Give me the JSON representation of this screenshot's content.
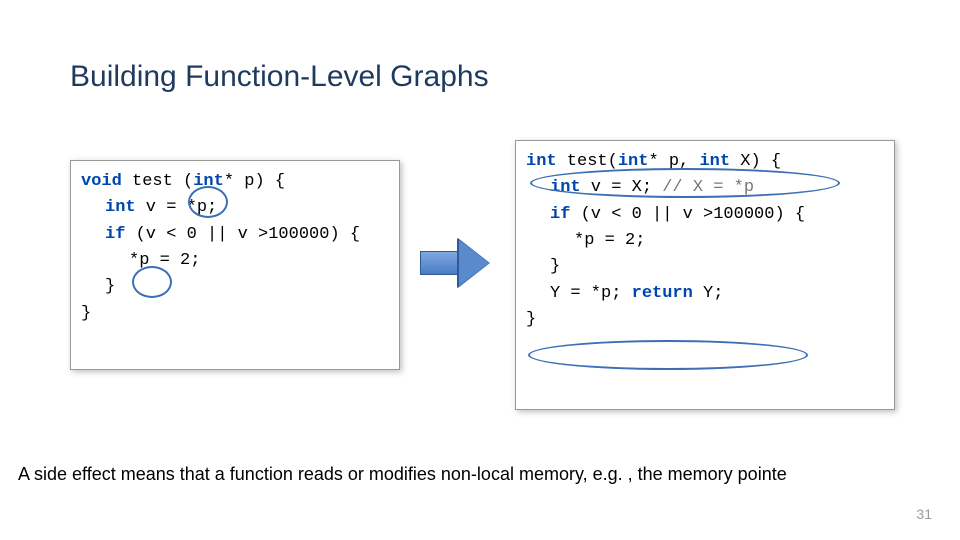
{
  "title": "Building Function-Level Graphs",
  "left_code": {
    "l1a": "void",
    "l1b": " test (",
    "l1c": "int",
    "l1d": "* p) {",
    "l2a": "int",
    "l2b": " v = *p;",
    "l3a": "if",
    "l3b": " (v < 0 || v >100000) {",
    "l4": "*p = 2;",
    "l5": "}",
    "l6": "}"
  },
  "right_code": {
    "l1a": "int",
    "l1b": " test(",
    "l1c": "int",
    "l1d": "* p, ",
    "l1e": "int",
    "l1f": " X) {",
    "l2a": "int",
    "l2b": " v = X; ",
    "l2c": "// X = *p",
    "l3a": "if",
    "l3b": " (v < 0 || v >100000) {",
    "l4": "*p = 2;",
    "l5": "}",
    "l6a": "Y = *p; ",
    "l6b": "return",
    "l6c": " Y;",
    "l7": "}"
  },
  "footer": "A side effect means that a function reads or modifies non-local memory, e.g. , the memory pointe",
  "page": "31"
}
